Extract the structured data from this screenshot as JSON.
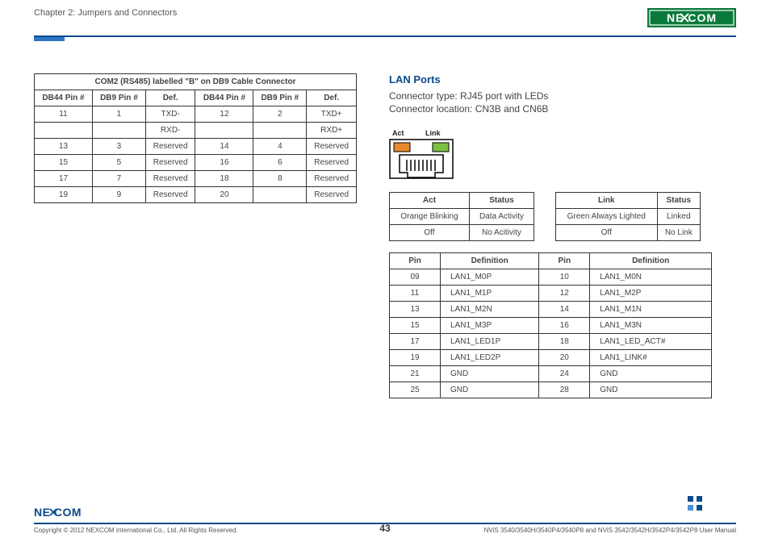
{
  "header": {
    "chapter": "Chapter 2: Jumpers and Connectors",
    "brand": "NEXCOM"
  },
  "com_table": {
    "title": "COM2 (RS485) labelled \"B\" on DB9 Cable Connector",
    "headers": [
      "DB44 Pin #",
      "DB9 Pin #",
      "Def.",
      "DB44 Pin #",
      "DB9 Pin #",
      "Def."
    ],
    "rows": [
      [
        "11",
        "1",
        "TXD-",
        "12",
        "2",
        "TXD+"
      ],
      [
        "",
        "",
        "RXD-",
        "",
        "",
        "RXD+"
      ],
      [
        "13",
        "3",
        "Reserved",
        "14",
        "4",
        "Reserved"
      ],
      [
        "15",
        "5",
        "Reserved",
        "16",
        "6",
        "Reserved"
      ],
      [
        "17",
        "7",
        "Reserved",
        "18",
        "8",
        "Reserved"
      ],
      [
        "19",
        "9",
        "Reserved",
        "20",
        "",
        "Reserved"
      ]
    ]
  },
  "lan": {
    "heading": "LAN Ports",
    "connector_type": "Connector type: RJ45 port with LEDs",
    "connector_location": "Connector location: CN3B and CN6B",
    "labels": {
      "act": "Act",
      "link": "Link"
    }
  },
  "act_table": {
    "headers": [
      "Act",
      "Status"
    ],
    "rows": [
      [
        "Orange Blinking",
        "Data Activity"
      ],
      [
        "Off",
        "No Acitivity"
      ]
    ]
  },
  "link_table": {
    "headers": [
      "Link",
      "Status"
    ],
    "rows": [
      [
        "Green Always Lighted",
        "Linked"
      ],
      [
        "Off",
        "No Link"
      ]
    ]
  },
  "pin_table": {
    "headers": [
      "Pin",
      "Definition",
      "Pin",
      "Definition"
    ],
    "rows": [
      [
        "09",
        "LAN1_M0P",
        "10",
        "LAN1_M0N"
      ],
      [
        "11",
        "LAN1_M1P",
        "12",
        "LAN1_M2P"
      ],
      [
        "13",
        "LAN1_M2N",
        "14",
        "LAN1_M1N"
      ],
      [
        "15",
        "LAN1_M3P",
        "16",
        "LAN1_M3N"
      ],
      [
        "17",
        "LAN1_LED1P",
        "18",
        "LAN1_LED_ACT#"
      ],
      [
        "19",
        "LAN1_LED2P",
        "20",
        "LAN1_LINK#"
      ],
      [
        "21",
        "GND",
        "24",
        "GND"
      ],
      [
        "25",
        "GND",
        "28",
        "GND"
      ]
    ]
  },
  "footer": {
    "copyright": "Copyright © 2012 NEXCOM International Co., Ltd. All Rights Reserved.",
    "page": "43",
    "doc": "NViS 3540/3540H/3540P4/3540P8 and NViS 3542/3542H/3542P4/3542P8 User Manual"
  }
}
